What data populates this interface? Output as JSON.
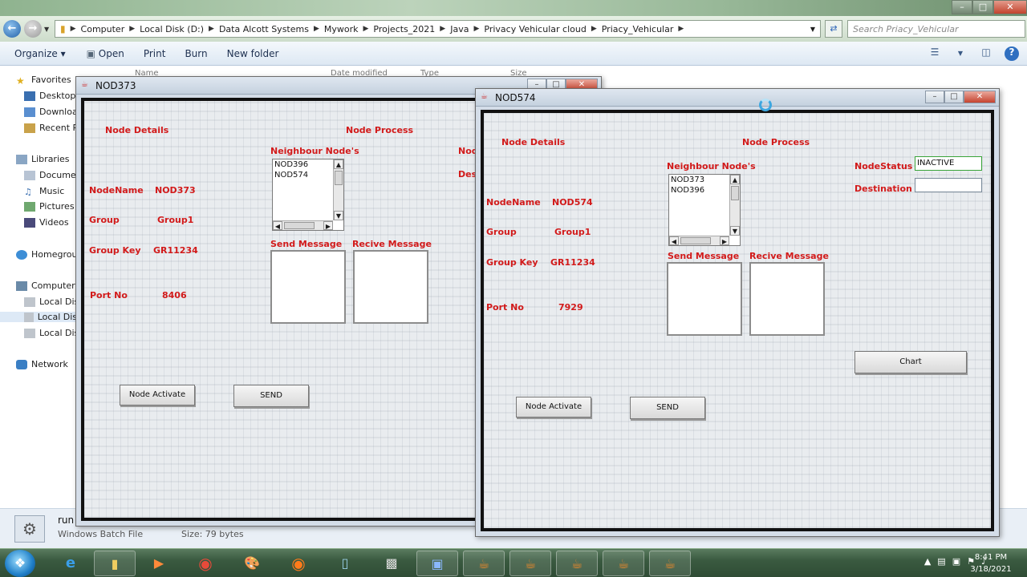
{
  "explorer": {
    "breadcrumbs": [
      "Computer",
      "Local Disk (D:)",
      "Data Alcott Systems",
      "Mywork",
      "Projects_2021",
      "Java",
      "Privacy Vehicular cloud",
      "Priacy_Vehicular"
    ],
    "search_placeholder": "Search Priacy_Vehicular",
    "commands": [
      "Organize",
      "Open",
      "Print",
      "Burn",
      "New folder"
    ],
    "nav_items": [
      {
        "label": "Favorites",
        "icon": "star-icon"
      },
      {
        "label": "Desktop",
        "icon": "desktop-icon"
      },
      {
        "label": "Downloa",
        "icon": "downloads-icon"
      },
      {
        "label": "Recent Pl",
        "icon": "recent-places-icon"
      },
      {
        "label": "Libraries",
        "icon": "library-icon"
      },
      {
        "label": "Documen",
        "icon": "documents-icon"
      },
      {
        "label": "Music",
        "icon": "music-icon"
      },
      {
        "label": "Pictures",
        "icon": "pictures-icon"
      },
      {
        "label": "Videos",
        "icon": "videos-icon"
      },
      {
        "label": "Homegrou",
        "icon": "homegroup-icon"
      },
      {
        "label": "Computer",
        "icon": "computer-icon"
      },
      {
        "label": "Local Dis",
        "icon": "drive-icon"
      },
      {
        "label": "Local Dis",
        "icon": "drive-icon"
      },
      {
        "label": "Local Dis",
        "icon": "drive-icon"
      },
      {
        "label": "Network",
        "icon": "network-icon"
      }
    ],
    "column_headers_ghost": [
      "Name",
      "Date modified",
      "Type",
      "Size"
    ],
    "details": {
      "name": "run",
      "type": "Windows Batch File",
      "size": "Size: 79 bytes"
    }
  },
  "frames": [
    {
      "title": "NOD373",
      "node_details_label": "Node Details",
      "node_process_label": "Node Process",
      "neighbour_label": "Neighbour Node's",
      "neighbours": [
        "NOD396",
        "NOD574"
      ],
      "send_label": "Send Message",
      "recv_label": "Recive Message",
      "fields": {
        "name_label": "NodeName",
        "name": "NOD373",
        "group_label": "Group",
        "group": "Group1",
        "key_label": "Group Key",
        "key": "GR11234",
        "port_label": "Port No",
        "port": "8406"
      },
      "activate_label": "Node Activate",
      "send_button": "SEND",
      "status_label_partial": "Nod",
      "destination_label_partial": "Des"
    },
    {
      "title": "NOD574",
      "node_details_label": "Node Details",
      "node_process_label": "Node Process",
      "neighbour_label": "Neighbour Node's",
      "neighbours": [
        "NOD373",
        "NOD396"
      ],
      "send_label": "Send Message",
      "recv_label": "Recive Message",
      "fields": {
        "name_label": "NodeName",
        "name": "NOD574",
        "group_label": "Group",
        "group": "Group1",
        "key_label": "Group Key",
        "key": "GR11234",
        "port_label": "Port No",
        "port": "7929"
      },
      "activate_label": "Node Activate",
      "send_button": "SEND",
      "status_label": "NodeStatus",
      "status_value": "INACTIVE",
      "destination_label": "Destination",
      "destination_value": "",
      "chart_button": "Chart"
    }
  ],
  "taskbar": {
    "time": "8:41 PM",
    "date": "3/18/2021"
  }
}
